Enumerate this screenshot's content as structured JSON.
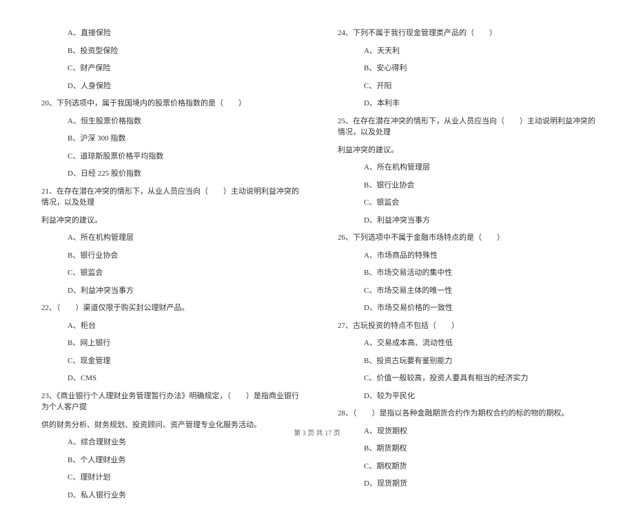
{
  "left_column": {
    "q19_options": [
      "A、直接保险",
      "B、投资型保险",
      "C、财产保险",
      "D、人身保险"
    ],
    "q20": {
      "text": "20、下列选项中，属于我国境内的股票价格指数的是（　　）",
      "options": [
        "A、恒生股票价格指数",
        "B、沪深 300 指数",
        "C、道琼斯股票价格平均指数",
        "D、日经 225 股价指数"
      ]
    },
    "q21": {
      "text": "21、在存在潜在冲突的情形下，从业人员应当向（　　）主动说明利益冲突的情况，以及处理",
      "cont": "利益冲突的建议。",
      "options": [
        "A、所在机构管理层",
        "B、银行业协会",
        "C、银监会",
        "D、利益冲突当事方"
      ]
    },
    "q22": {
      "text": "22、（　　）渠道仅限于购买封公理财产品。",
      "options": [
        "A、柜台",
        "B、网上银行",
        "C、现金管理",
        "D、CMS"
      ]
    },
    "q23": {
      "text": "23、《商业银行个人理财业务管理暂行办法》明确规定，（　　）是指商业银行为个人客户提",
      "cont": "供的财务分析、财务规划、投资顾问、资产管理专业化服务活动。",
      "options": [
        "A、综合理财业务",
        "B、个人理财业务",
        "C、理财计划",
        "D、私人银行业务"
      ]
    }
  },
  "right_column": {
    "q24": {
      "text": "24、下列不属于我行现金管理类产品的（　　）",
      "options": [
        "A、天天利",
        "B、安心得利",
        "C、开阳",
        "D、本利丰"
      ]
    },
    "q25": {
      "text": "25、在存在潜在冲突的情形下，从业人员应当向（　　）主动说明利益冲突的情况，以及处理",
      "cont": "利益冲突的建议。",
      "options": [
        "A、所在机构管理层",
        "B、银行业协会",
        "C、银监会",
        "D、利益冲突当事方"
      ]
    },
    "q26": {
      "text": "26、下列选项中不属于金融市场特点的是（　　）",
      "options": [
        "A、市场商品的特殊性",
        "B、市场交易活动的集中性",
        "C、市场交易主体的唯一性",
        "D、市场交易价格的一致性"
      ]
    },
    "q27": {
      "text": "27、古玩投资的特点不包括（　　）",
      "options": [
        "A、交易成本高、流动性低",
        "B、投资古玩要有鉴别能力",
        "C、价值一般较高，投资人要具有相当的经济实力",
        "D、较为平民化"
      ]
    },
    "q28": {
      "text": "28、（　　）是指以各种金融期货合约作为期权合约的标的物的期权。",
      "options": [
        "A、现货期权",
        "B、期货期权",
        "C、期权期货",
        "D、现货期货"
      ]
    }
  },
  "footer": "第 3 页 共 17 页"
}
